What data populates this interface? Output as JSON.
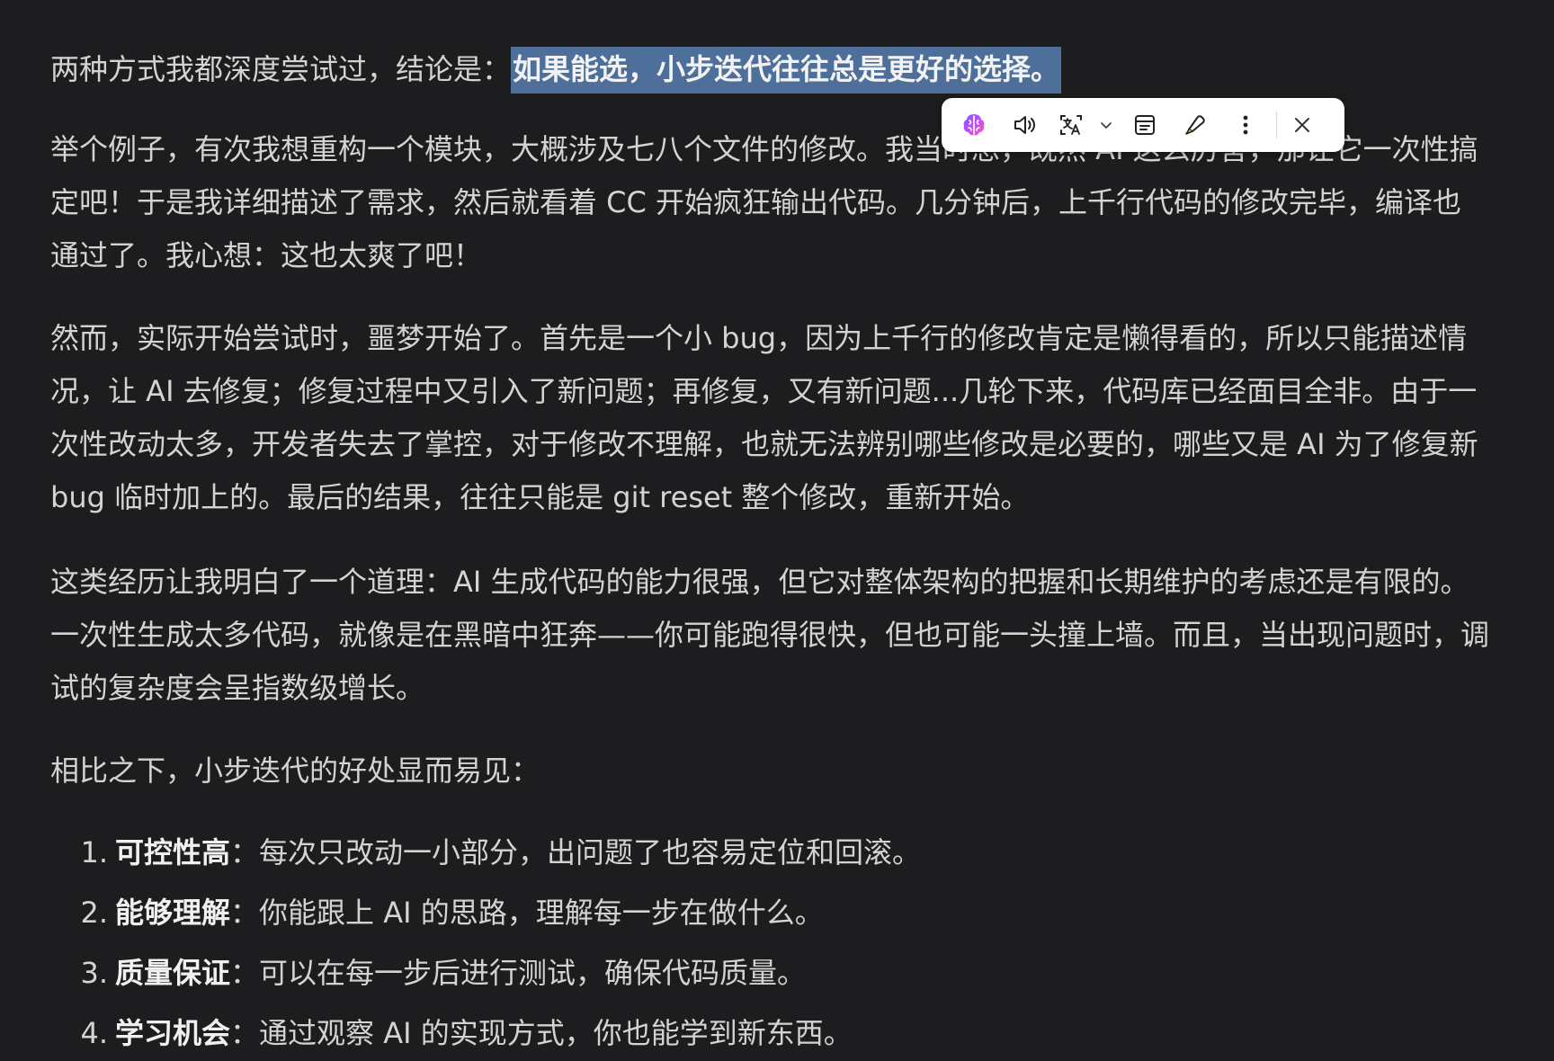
{
  "article": {
    "intro_prefix": "两种方式我都深度尝试过，结论是：",
    "intro_highlight": "如果能选，小步迭代往往总是更好的选择。",
    "para1": "举个例子，有次我想重构一个模块，大概涉及七八个文件的修改。我当时想，既然 AI 这么厉害，那让它一次性搞定吧！于是我详细描述了需求，然后就看着 CC 开始疯狂输出代码。几分钟后，上千行代码的修改完毕，编译也通过了。我心想：这也太爽了吧！",
    "para2": "然而，实际开始尝试时，噩梦开始了。首先是一个小 bug，因为上千行的修改肯定是懒得看的，所以只能描述情况，让 AI 去修复；修复过程中又引入了新问题；再修复，又有新问题...几轮下来，代码库已经面目全非。由于一次性改动太多，开发者失去了掌控，对于修改不理解，也就无法辨别哪些修改是必要的，哪些又是 AI 为了修复新 bug 临时加上的。最后的结果，往往只能是 git reset 整个修改，重新开始。",
    "para3": "这类经历让我明白了一个道理：AI 生成代码的能力很强，但它对整体架构的把握和长期维护的考虑还是有限的。一次性生成太多代码，就像是在黑暗中狂奔——你可能跑得很快，但也可能一头撞上墙。而且，当出现问题时，调试的复杂度会呈指数级增长。",
    "para4": "相比之下，小步迭代的好处显而易见：",
    "list": [
      {
        "num": "1.",
        "term": "可控性高",
        "sep": "：",
        "desc": "每次只改动一小部分，出问题了也容易定位和回滚。"
      },
      {
        "num": "2.",
        "term": "能够理解",
        "sep": "：",
        "desc": "你能跟上 AI 的思路，理解每一步在做什么。"
      },
      {
        "num": "3.",
        "term": "质量保证",
        "sep": "：",
        "desc": "可以在每一步后进行测试，确保代码质量。"
      },
      {
        "num": "4.",
        "term": "学习机会",
        "sep": "：",
        "desc": "通过观察 AI 的实现方式，你也能学到新东西。"
      }
    ]
  },
  "toolbar": {
    "icons": [
      "brain-ai-icon",
      "speaker-icon",
      "translate-icon",
      "chevron-down-icon",
      "summary-icon",
      "highlight-pen-icon",
      "more-vertical-icon",
      "close-icon"
    ]
  },
  "colors": {
    "background": "#1d1d1f",
    "text": "#d3d3d3",
    "highlight": "#4d6f9a",
    "toolbar_bg": "#ffffff"
  }
}
